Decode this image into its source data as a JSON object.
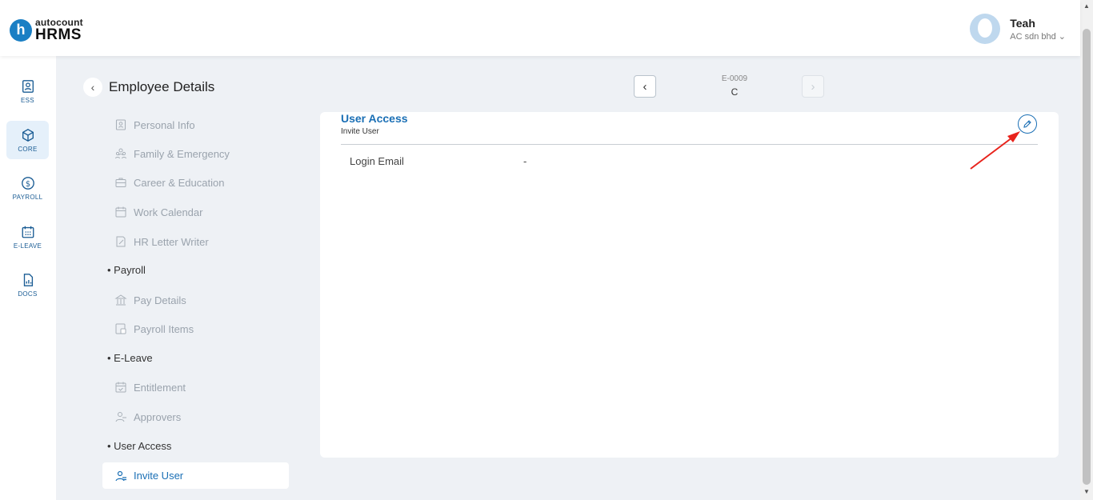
{
  "header": {
    "logo_top": "autocount",
    "logo_bottom": "HRMS",
    "logo_letter": "h",
    "user_name": "Teah",
    "user_company": "AC sdn bhd",
    "company_dropdown_icon": "chevron-down-icon"
  },
  "rail": {
    "items": [
      {
        "label": "ESS",
        "icon": "id-card-icon"
      },
      {
        "label": "CORE",
        "icon": "cube-icon"
      },
      {
        "label": "PAYROLL",
        "icon": "dollar-circle-icon"
      },
      {
        "label": "E-LEAVE",
        "icon": "calendar-icon"
      },
      {
        "label": "DOCS",
        "icon": "document-chart-icon"
      }
    ]
  },
  "page": {
    "title": "Employee Details",
    "back_icon": "chevron-left-icon"
  },
  "employee_nav": {
    "code": "E-0009",
    "name": "C",
    "prev_icon": "chevron-left-icon",
    "next_icon": "chevron-right-icon"
  },
  "side_menu": {
    "items": [
      {
        "label": "Personal Info",
        "icon": "id-card-icon"
      },
      {
        "label": "Family & Emergency",
        "icon": "family-icon"
      },
      {
        "label": "Career & Education",
        "icon": "briefcase-icon"
      },
      {
        "label": "Work Calendar",
        "icon": "calendar-icon"
      },
      {
        "label": "HR Letter Writer",
        "icon": "letter-icon"
      }
    ],
    "sections": {
      "payroll": "Payroll",
      "eleave": "E-Leave",
      "user_access": "User Access"
    },
    "payroll_items": [
      {
        "label": "Pay Details",
        "icon": "bank-icon"
      },
      {
        "label": "Payroll Items",
        "icon": "payslip-icon"
      }
    ],
    "eleave_items": [
      {
        "label": "Entitlement",
        "icon": "calendar-check-icon"
      },
      {
        "label": "Approvers",
        "icon": "user-icon"
      }
    ],
    "active_item": {
      "label": "Invite User",
      "icon": "user-invite-icon"
    }
  },
  "card": {
    "title": "User Access",
    "subtitle": "Invite User",
    "edit_icon": "pencil-icon",
    "fields": [
      {
        "label": "Login Email",
        "value": "-"
      }
    ]
  },
  "colors": {
    "accent": "#1a6fb5",
    "annotation_arrow": "#e8231c"
  }
}
